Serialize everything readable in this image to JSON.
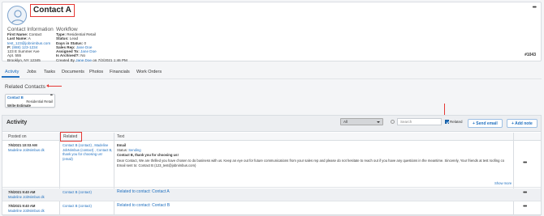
{
  "contact": {
    "name": "Contact A",
    "info_heading": "Contact Information",
    "first_name_label": "First Name:",
    "first_name": "Contact",
    "last_name_label": "Last Name:",
    "last_name": "A",
    "email": "test_123@jobnimbus.com",
    "phone_label": "P:",
    "phone": "(888) 123-1234",
    "address1": "123 E Summer Ave",
    "address2": "Apt. 555",
    "address3": "Brooklyn, NY 12345",
    "job_number": "#1043"
  },
  "workflow": {
    "heading": "Workflow",
    "type_label": "Type:",
    "type": "Residential Retail",
    "status_label": "Status:",
    "status": "Lead",
    "days_label": "Days in Status:",
    "days": "0",
    "sales_rep_label": "Sales Rep:",
    "sales_rep": "Jane Doe",
    "assigned_label": "Assigned To:",
    "assigned": "Jane Doe",
    "archived_label": "Is Archived?:",
    "archived": "No",
    "created_label": "Created By",
    "created_by": "Jane Doe",
    "created_on": "on 7/2/2021 1:46 PM"
  },
  "tabs": [
    "Activity",
    "Jobs",
    "Tasks",
    "Documents",
    "Photos",
    "Financials",
    "Work Orders"
  ],
  "related_contacts": {
    "title": "Related Contacts",
    "card_name": "Contact B",
    "card_type": "Residential Retail",
    "card_status": "Write Estimate"
  },
  "activity": {
    "title": "Activity",
    "filter_value": "All",
    "search_placeholder": "Search",
    "related_checkbox_label": "Related",
    "send_email_label": "+ Send email",
    "add_note_label": "+ Add note",
    "col_posted": "Posted on",
    "col_related": "Related",
    "col_text": "Text",
    "rows": [
      {
        "date": "7/6/2021 10:03 AM",
        "author": "Madeline JobNimbus dk",
        "related": "Contact B (contact) , Madeline JobNimbus (contact) , Contact B, thank you for choosing us! (email)",
        "type": "Email",
        "status_label": "Status:",
        "status": "Sending",
        "subject": "Contact B, thank you for choosing us!",
        "body": "Dear Contact,  We are thrilled you have chosen to do business with us. Keep an eye out for future communications from your sales rep and please do not hesitate to reach out if you have any questions in the meantime.   Sincerely, Your friends at test roofing co",
        "sent_to": "Email sent to: Contact B (123_test@jobnimbus.com)",
        "show_more": "Show more"
      },
      {
        "date": "7/6/2021 9:40 AM",
        "author": "Madeline JobNimbus dk",
        "related": "Contact B (contact)",
        "text": "Related to contact: Contact A"
      },
      {
        "date": "7/6/2021 9:40 AM",
        "author": "Madeline JobNimbus dk",
        "related": "Contact B (contact)",
        "text": "Related to contact: Contact B"
      }
    ]
  }
}
